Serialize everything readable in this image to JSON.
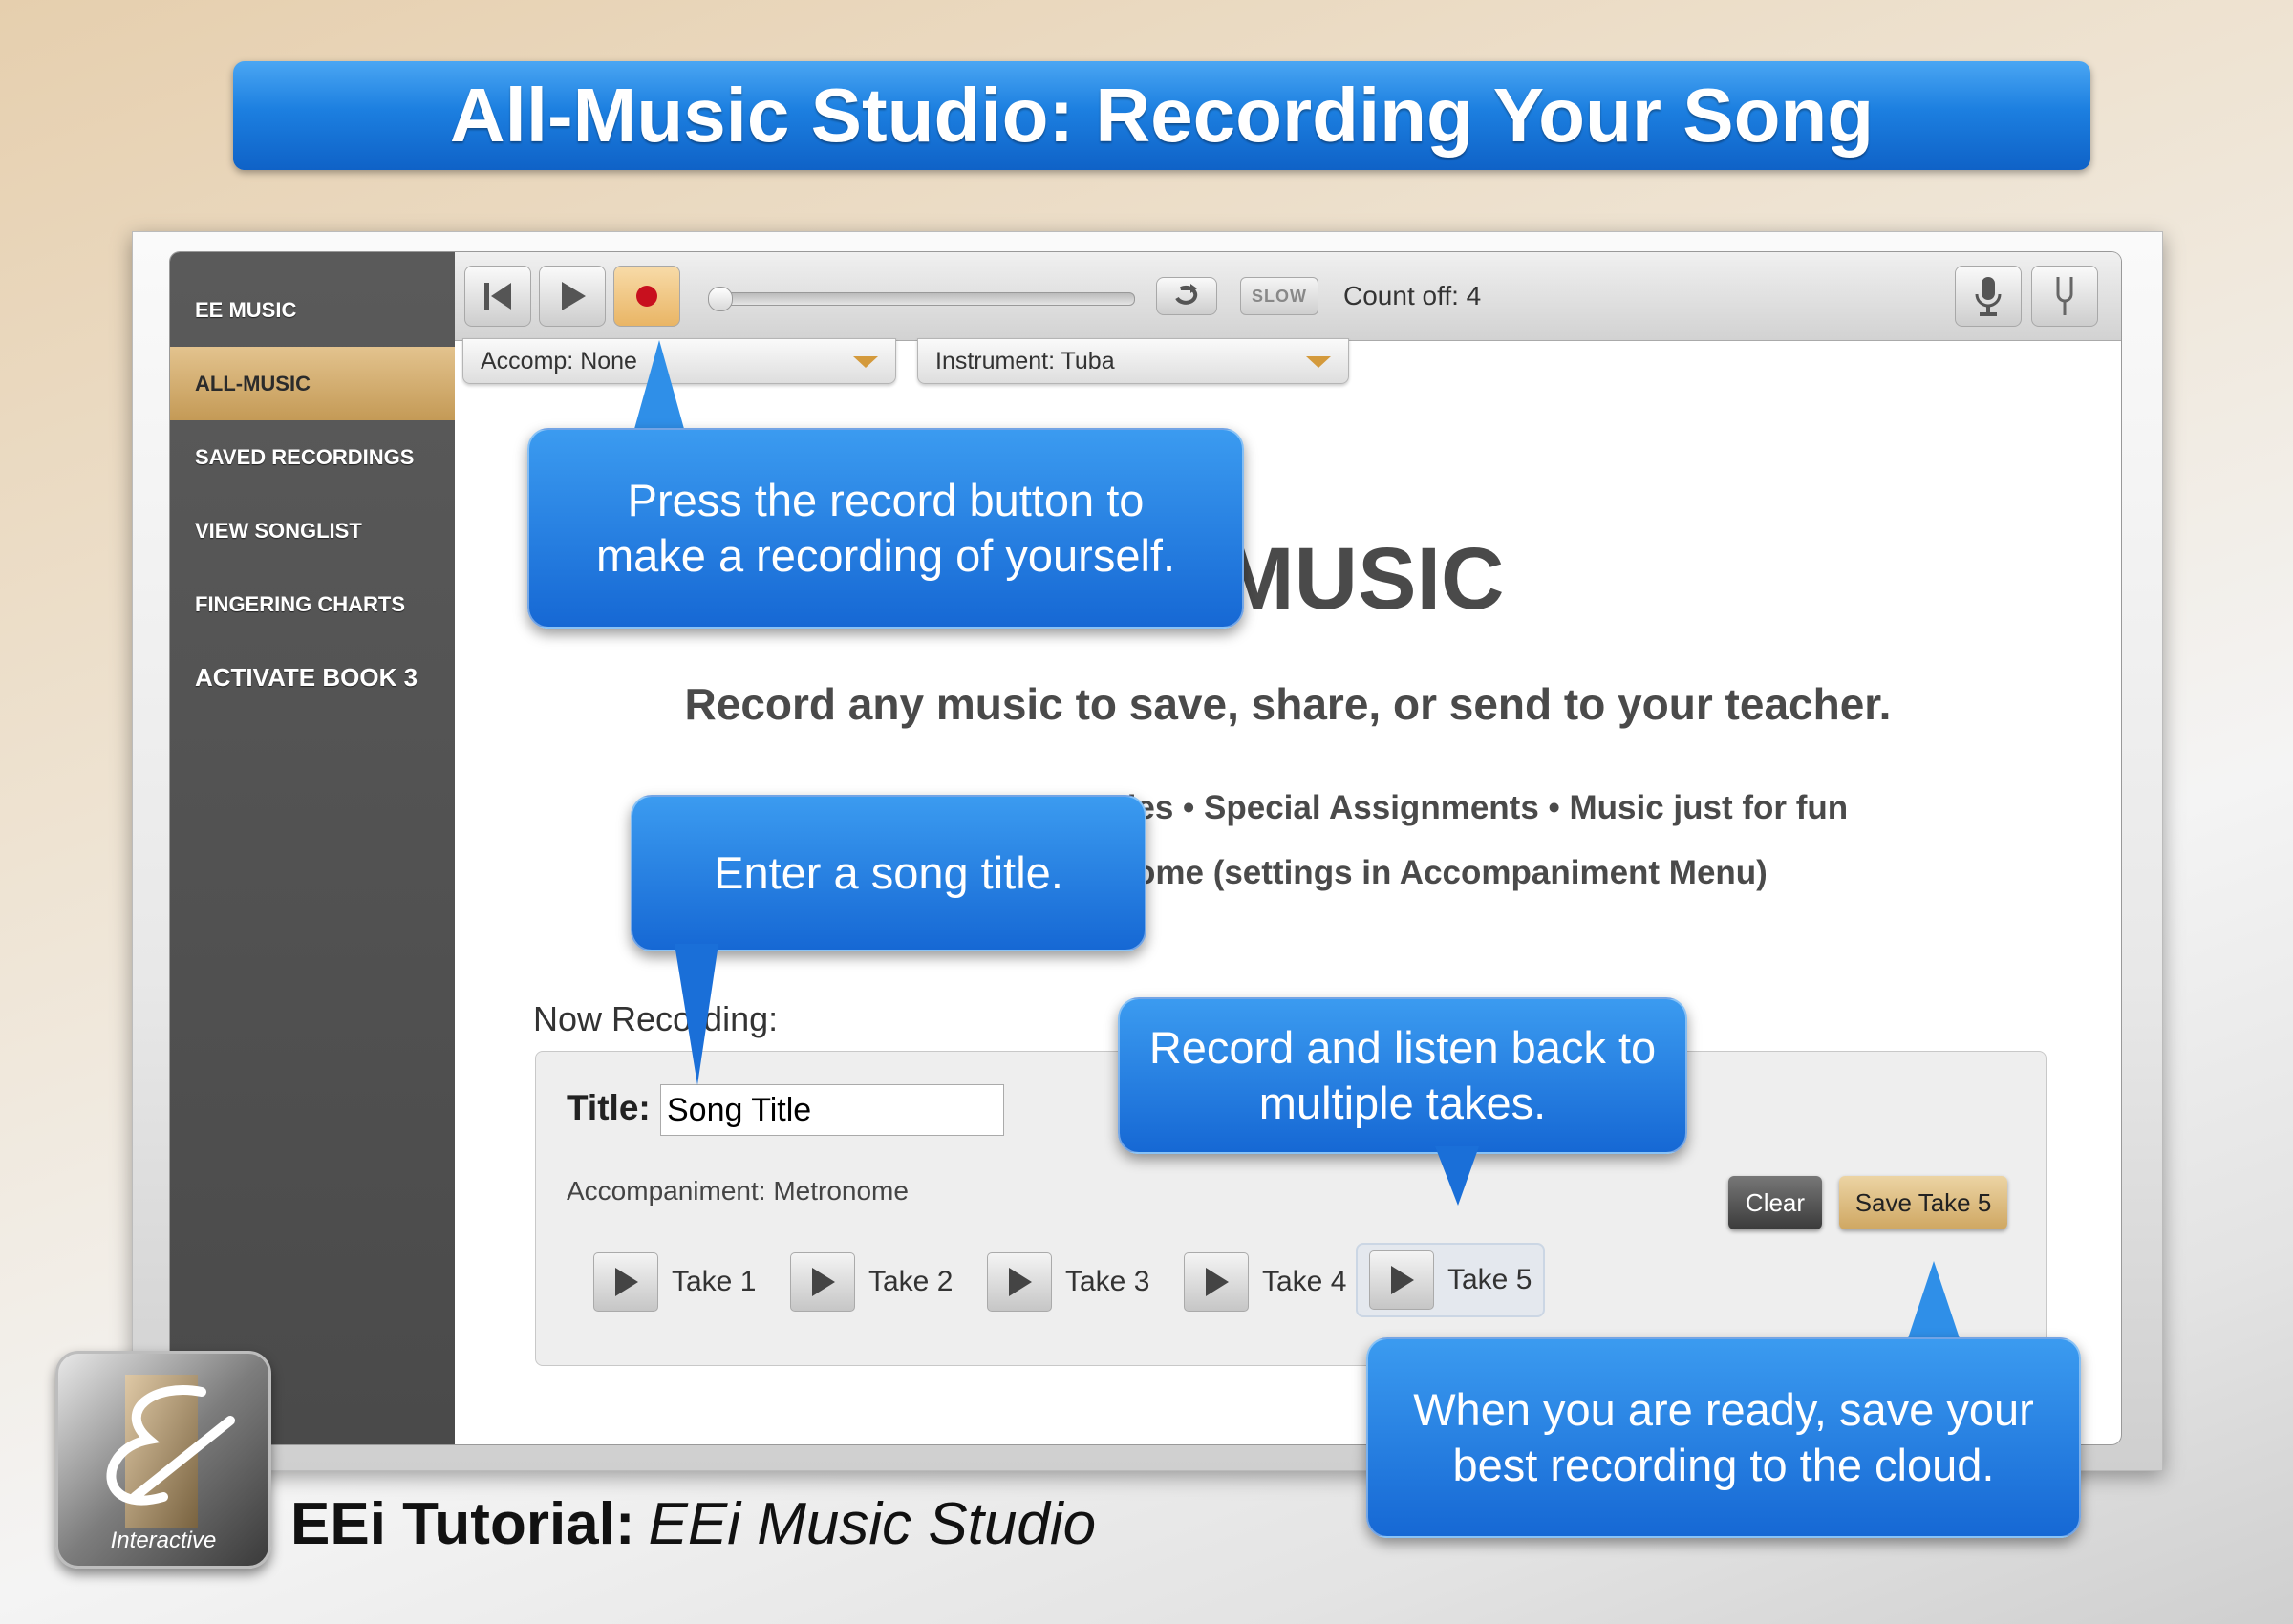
{
  "banner": {
    "title": "All-Music Studio: Recording Your Song"
  },
  "sidebar": {
    "items": [
      {
        "label": "EE MUSIC"
      },
      {
        "label": "ALL-MUSIC"
      },
      {
        "label": "SAVED RECORDINGS"
      },
      {
        "label": "VIEW SONGLIST"
      },
      {
        "label": "FINGERING CHARTS"
      },
      {
        "label": "ACTIVATE BOOK 3"
      }
    ],
    "active_index": 1
  },
  "toolbar": {
    "slow_label": "SLOW",
    "count_off": "Count off: 4",
    "progress": 0
  },
  "dropdowns": {
    "accomp": "Accomp: None",
    "instrument": "Instrument: Tuba"
  },
  "main": {
    "title_partial": "MUSIC",
    "subtitle": "Record any music to save, share, or send to your teacher.",
    "bullet_line_1": "des • Special Assignments • Music just for fun",
    "bullet_line_2": "ome (settings in Accompaniment Menu)"
  },
  "recording": {
    "heading": "Now Recording:",
    "title_label": "Title:",
    "title_value": "Song Title",
    "accompaniment": "Accompaniment: Metronome",
    "takes": [
      "Take 1",
      "Take 2",
      "Take 3",
      "Take 4",
      "Take 5"
    ],
    "selected_take_index": 4,
    "clear_label": "Clear",
    "save_label": "Save Take 5"
  },
  "callouts": {
    "record": "Press the record button to make a recording of yourself.",
    "title": "Enter a song title.",
    "takes": "Record and listen back to multiple takes.",
    "save": "When you are ready, save your best recording to the cloud."
  },
  "logo": {
    "text": "Interactive"
  },
  "footer": {
    "bold": "EEi Tutorial:",
    "italic": "EEi Music Studio"
  },
  "colors": {
    "callout_blue": "#1c7fe0",
    "record_red": "#c8101e",
    "gold": "#d9b16f",
    "sidebar_dark": "#4f4f4f"
  }
}
